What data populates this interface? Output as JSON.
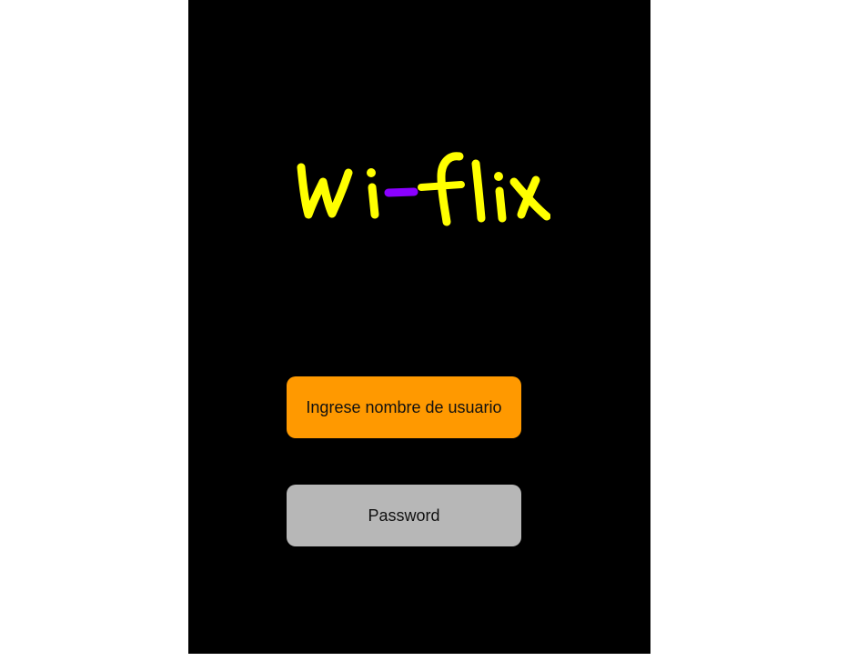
{
  "app": {
    "logo_text": "Wi-flix",
    "logo_colors": {
      "letters": "#ffff00",
      "dash": "#8a00ff"
    },
    "background": "#000000"
  },
  "login": {
    "username": {
      "placeholder": "Ingrese nombre de usuario",
      "color": "#ff9900"
    },
    "password": {
      "placeholder": "Password",
      "color": "#b7b7b7"
    }
  }
}
